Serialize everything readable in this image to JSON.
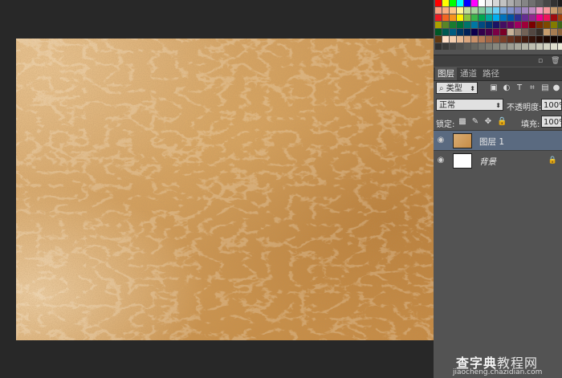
{
  "canvas": {
    "texture": "brown leather"
  },
  "swatches": {
    "colors": [
      "#ff0000",
      "#ffff00",
      "#00ff00",
      "#00ffff",
      "#0000ff",
      "#ff00ff",
      "#ffffff",
      "#ebebeb",
      "#d6d6d6",
      "#c2c2c2",
      "#adadad",
      "#999999",
      "#858585",
      "#707070",
      "#5c5c5c",
      "#474747",
      "#333333",
      "#1f1f1f",
      "#000000",
      "#f7a283",
      "#f9ad81",
      "#fdc689",
      "#fff799",
      "#c4df9b",
      "#a3d39c",
      "#82ca9c",
      "#7accc8",
      "#6dcff6",
      "#7da7d9",
      "#8393ca",
      "#8781bd",
      "#a186be",
      "#bd8cbf",
      "#f49ac2",
      "#f6989d",
      "#c69c6d",
      "#a67c52",
      "#8c6239",
      "#ed1c24",
      "#f26522",
      "#f7941d",
      "#fff200",
      "#8dc63f",
      "#39b54a",
      "#00a651",
      "#00a99d",
      "#00aeef",
      "#0072bc",
      "#0054a6",
      "#2e3192",
      "#662d91",
      "#92278f",
      "#ec008c",
      "#ed145b",
      "#9e0b0f",
      "#a0410d",
      "#a3620a",
      "#aba000",
      "#598527",
      "#197b30",
      "#007236",
      "#00746b",
      "#0076a3",
      "#004a80",
      "#003471",
      "#1b1464",
      "#440e62",
      "#630460",
      "#9e005d",
      "#9e0039",
      "#790000",
      "#7b2e00",
      "#7d4900",
      "#827b00",
      "#406618",
      "#005e20",
      "#005826",
      "#005952",
      "#005b7f",
      "#003663",
      "#002157",
      "#0d004c",
      "#32004b",
      "#4b0049",
      "#7b0046",
      "#7a0026",
      "#c7b299",
      "#998675",
      "#736357",
      "#534741",
      "#37302a",
      "#c69c6d",
      "#a67c52",
      "#8c6239",
      "#754c24",
      "#603913",
      "#ffe0c8",
      "#f5d0b0",
      "#e8bc96",
      "#d9a67e",
      "#c99068",
      "#b67a55",
      "#a36545",
      "#8f5236",
      "#7b4129",
      "#68321e",
      "#552515",
      "#421a0e",
      "#331209",
      "#260c05",
      "#1a0702",
      "#100401",
      "#080200",
      "#040100",
      "#30302f",
      "#3a3a38",
      "#454542",
      "#50504c",
      "#5b5b56",
      "#666660",
      "#71716a",
      "#7c7c74",
      "#87877e",
      "#929288",
      "#9d9d92",
      "#a8a89c",
      "#b3b3a6",
      "#bebeb0",
      "#c9c9ba",
      "#d4d4c4",
      "#dfdfce",
      "#eaead8",
      "#f5f5e2"
    ]
  },
  "layers_panel": {
    "tabs": [
      "图层",
      "通道",
      "路径"
    ],
    "filter_label": "类型",
    "blend_mode": "正常",
    "opacity_label": "不透明度:",
    "opacity_value": "100%",
    "lock_label": "锁定:",
    "fill_label": "填充:",
    "fill_value": "100%",
    "layers": [
      {
        "name": "图层 1",
        "selected": true,
        "thumb": "leather"
      },
      {
        "name": "背景",
        "selected": false,
        "thumb": "white",
        "locked": true
      }
    ]
  },
  "watermark": {
    "main": "查字典",
    "accent": "教程网",
    "sub": "jiaocheng.chazidian.com"
  }
}
